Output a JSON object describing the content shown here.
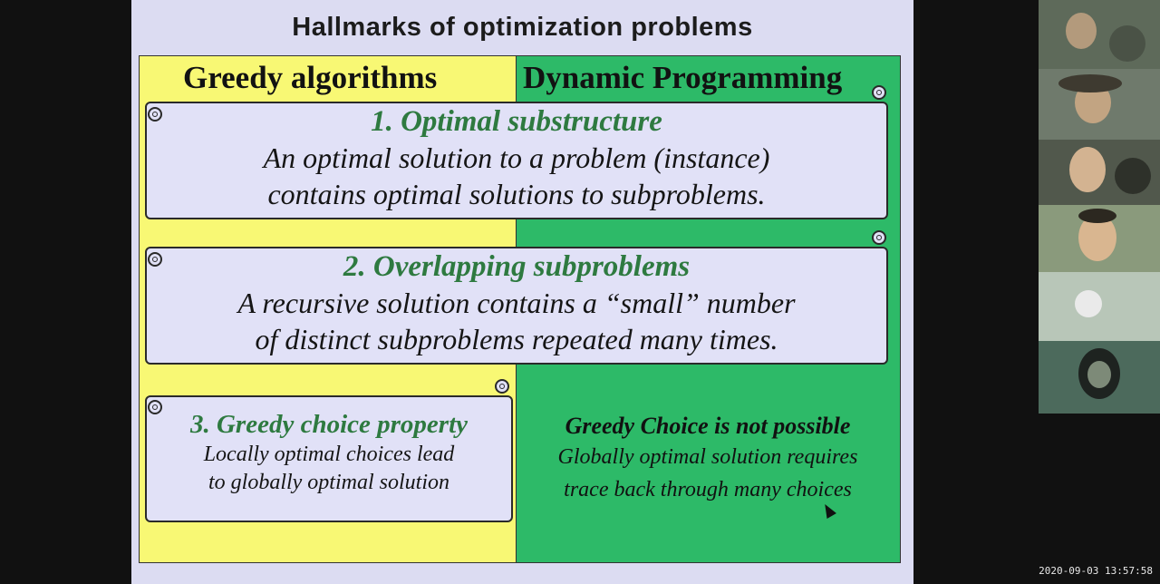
{
  "slide": {
    "title": "Hallmarks of optimization problems",
    "left_header": "Greedy algorithms",
    "right_header": "Dynamic Programming",
    "item1": {
      "title": "1. Optimal substructure",
      "line1": "An optimal solution to a problem (instance)",
      "line2": "contains optimal solutions to subproblems."
    },
    "item2": {
      "title": "2. Overlapping subproblems",
      "line1": "A recursive solution contains a “small” number",
      "line2": "of distinct subproblems repeated many times."
    },
    "item3": {
      "title": "3. Greedy choice property",
      "line1": "Locally optimal choices lead",
      "line2": "to globally optimal solution"
    },
    "dp_note": {
      "title": "Greedy Choice is not possible",
      "line1": "Globally optimal solution requires",
      "line2": "trace back through many choices"
    },
    "colors": {
      "greedy_panel": "#f8f874",
      "dp_panel": "#2dba68",
      "scroll_fill": "#e1e1f7",
      "heading_green": "#2e7a40"
    }
  },
  "participants": [
    "video-tile",
    "video-tile",
    "video-tile",
    "video-tile",
    "video-tile",
    "video-tile"
  ],
  "timestamp": "2020-09-03 13:57:58"
}
